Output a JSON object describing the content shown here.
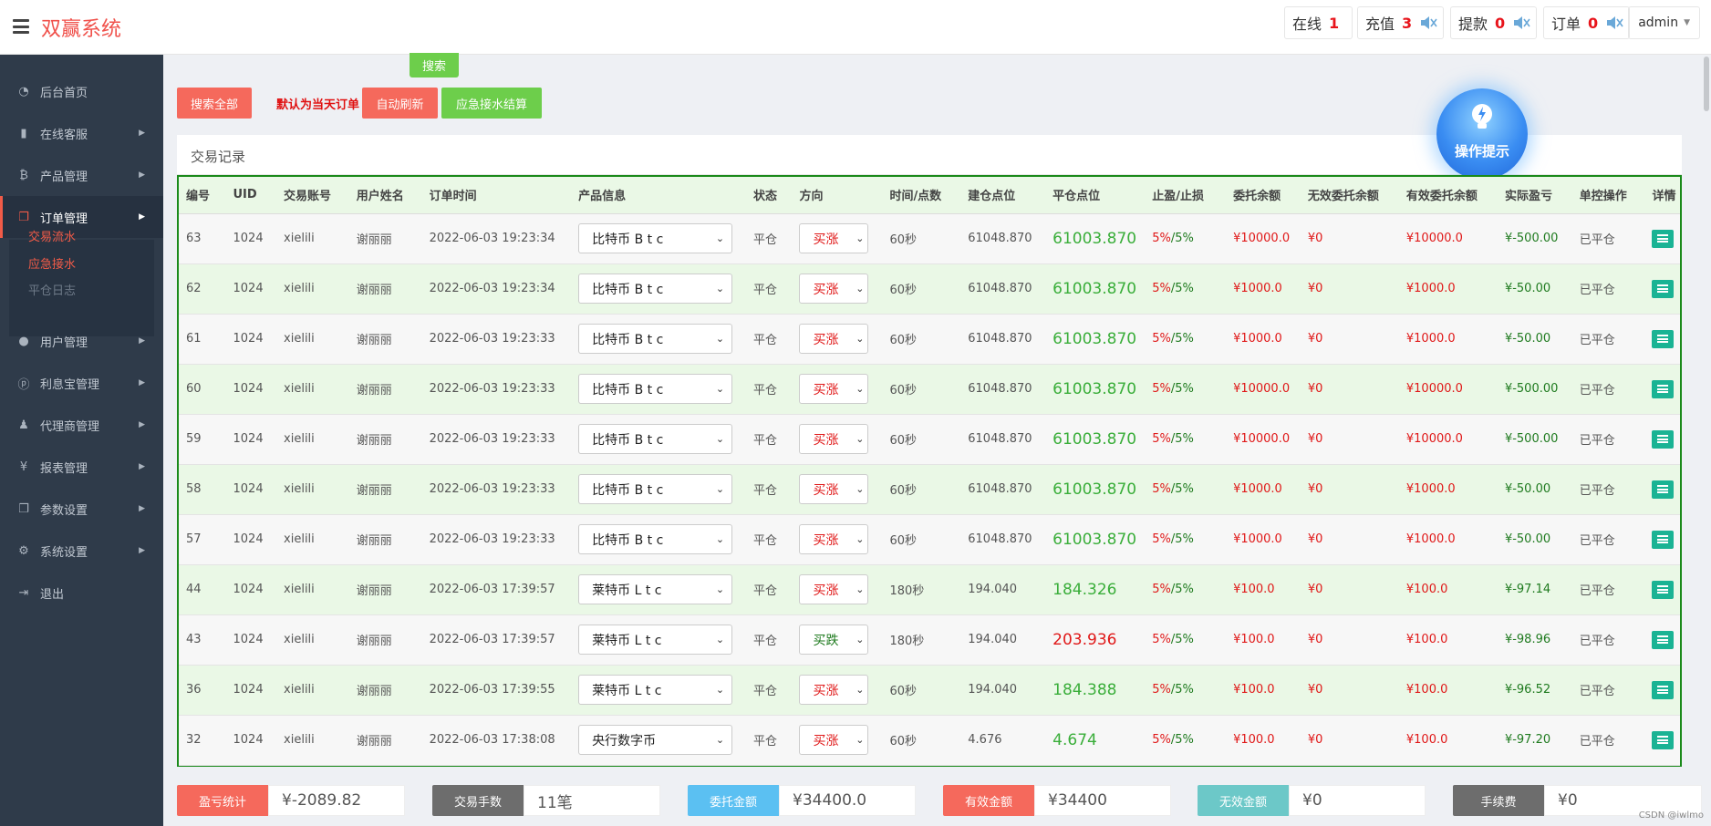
{
  "app": {
    "title": "双赢系统"
  },
  "header": {
    "online": {
      "label": "在线",
      "count": "1"
    },
    "recharge": {
      "label": "充值",
      "count": "3"
    },
    "withdraw": {
      "label": "提款",
      "count": "0"
    },
    "orders": {
      "label": "订单",
      "count": "0"
    },
    "user": "admin"
  },
  "sidebar": {
    "items": [
      {
        "label": "后台首页",
        "icon": "dashboard-icon"
      },
      {
        "label": "在线客服",
        "icon": "book-icon"
      },
      {
        "label": "产品管理",
        "icon": "bitcoin-icon"
      },
      {
        "label": "订单管理",
        "icon": "copy-icon"
      },
      {
        "label": "用户管理",
        "icon": "user-icon"
      },
      {
        "label": "利息宝管理",
        "icon": "pinterest-icon"
      },
      {
        "label": "代理商管理",
        "icon": "agent-icon"
      },
      {
        "label": "报表管理",
        "icon": "yen-icon"
      },
      {
        "label": "参数设置",
        "icon": "copy-icon"
      },
      {
        "label": "系统设置",
        "icon": "gears-icon"
      },
      {
        "label": "退出",
        "icon": "sign-out-icon"
      }
    ],
    "submenu": [
      "交易流水",
      "应急接水",
      "平仓日志"
    ]
  },
  "toolbar": {
    "search": "搜索",
    "search_all": "搜索全部",
    "default_note": "默认为当天订单",
    "auto_refresh": "自动刷新",
    "emergency_settle": "应急接水结算"
  },
  "panel": {
    "title": "交易记录"
  },
  "tip": {
    "label": "操作提示"
  },
  "table": {
    "headers": [
      "编号",
      "UID",
      "交易账号",
      "用户姓名",
      "订单时间",
      "产品信息",
      "状态",
      "方向",
      "时间/点数",
      "建仓点位",
      "平仓点位",
      "止盈/止损",
      "委托余额",
      "无效委托余额",
      "有效委托余额",
      "实际盈亏",
      "单控操作",
      "详情"
    ],
    "rows": [
      {
        "id": "63",
        "uid": "1024",
        "account": "xielili",
        "name": "谢丽丽",
        "time": "2022-06-03 19:23:34",
        "product": "比特币 B t c",
        "status": "平仓",
        "direction": "买涨",
        "duration": "60秒",
        "open": "61048.870",
        "close": "61003.870",
        "tp": "5%",
        "sl": "/5%",
        "amount": "¥10000.0",
        "invalid": "¥0",
        "valid": "¥10000.0",
        "pnl": "¥-500.00",
        "ctrl": "已平仓"
      },
      {
        "id": "62",
        "uid": "1024",
        "account": "xielili",
        "name": "谢丽丽",
        "time": "2022-06-03 19:23:34",
        "product": "比特币 B t c",
        "status": "平仓",
        "direction": "买涨",
        "duration": "60秒",
        "open": "61048.870",
        "close": "61003.870",
        "tp": "5%",
        "sl": "/5%",
        "amount": "¥1000.0",
        "invalid": "¥0",
        "valid": "¥1000.0",
        "pnl": "¥-50.00",
        "ctrl": "已平仓"
      },
      {
        "id": "61",
        "uid": "1024",
        "account": "xielili",
        "name": "谢丽丽",
        "time": "2022-06-03 19:23:33",
        "product": "比特币 B t c",
        "status": "平仓",
        "direction": "买涨",
        "duration": "60秒",
        "open": "61048.870",
        "close": "61003.870",
        "tp": "5%",
        "sl": "/5%",
        "amount": "¥1000.0",
        "invalid": "¥0",
        "valid": "¥1000.0",
        "pnl": "¥-50.00",
        "ctrl": "已平仓"
      },
      {
        "id": "60",
        "uid": "1024",
        "account": "xielili",
        "name": "谢丽丽",
        "time": "2022-06-03 19:23:33",
        "product": "比特币 B t c",
        "status": "平仓",
        "direction": "买涨",
        "duration": "60秒",
        "open": "61048.870",
        "close": "61003.870",
        "tp": "5%",
        "sl": "/5%",
        "amount": "¥10000.0",
        "invalid": "¥0",
        "valid": "¥10000.0",
        "pnl": "¥-500.00",
        "ctrl": "已平仓"
      },
      {
        "id": "59",
        "uid": "1024",
        "account": "xielili",
        "name": "谢丽丽",
        "time": "2022-06-03 19:23:33",
        "product": "比特币 B t c",
        "status": "平仓",
        "direction": "买涨",
        "duration": "60秒",
        "open": "61048.870",
        "close": "61003.870",
        "tp": "5%",
        "sl": "/5%",
        "amount": "¥10000.0",
        "invalid": "¥0",
        "valid": "¥10000.0",
        "pnl": "¥-500.00",
        "ctrl": "已平仓"
      },
      {
        "id": "58",
        "uid": "1024",
        "account": "xielili",
        "name": "谢丽丽",
        "time": "2022-06-03 19:23:33",
        "product": "比特币 B t c",
        "status": "平仓",
        "direction": "买涨",
        "duration": "60秒",
        "open": "61048.870",
        "close": "61003.870",
        "tp": "5%",
        "sl": "/5%",
        "amount": "¥1000.0",
        "invalid": "¥0",
        "valid": "¥1000.0",
        "pnl": "¥-50.00",
        "ctrl": "已平仓"
      },
      {
        "id": "57",
        "uid": "1024",
        "account": "xielili",
        "name": "谢丽丽",
        "time": "2022-06-03 19:23:33",
        "product": "比特币 B t c",
        "status": "平仓",
        "direction": "买涨",
        "duration": "60秒",
        "open": "61048.870",
        "close": "61003.870",
        "tp": "5%",
        "sl": "/5%",
        "amount": "¥1000.0",
        "invalid": "¥0",
        "valid": "¥1000.0",
        "pnl": "¥-50.00",
        "ctrl": "已平仓"
      },
      {
        "id": "44",
        "uid": "1024",
        "account": "xielili",
        "name": "谢丽丽",
        "time": "2022-06-03 17:39:57",
        "product": "莱特币 L t c",
        "status": "平仓",
        "direction": "买涨",
        "duration": "180秒",
        "open": "194.040",
        "close": "184.326",
        "tp": "5%",
        "sl": "/5%",
        "amount": "¥100.0",
        "invalid": "¥0",
        "valid": "¥100.0",
        "pnl": "¥-97.14",
        "ctrl": "已平仓"
      },
      {
        "id": "43",
        "uid": "1024",
        "account": "xielili",
        "name": "谢丽丽",
        "time": "2022-06-03 17:39:57",
        "product": "莱特币 L t c",
        "status": "平仓",
        "direction": "买跌",
        "duration": "180秒",
        "open": "194.040",
        "close": "203.936",
        "tp": "5%",
        "sl": "/5%",
        "amount": "¥100.0",
        "invalid": "¥0",
        "valid": "¥100.0",
        "pnl": "¥-98.96",
        "ctrl": "已平仓"
      },
      {
        "id": "36",
        "uid": "1024",
        "account": "xielili",
        "name": "谢丽丽",
        "time": "2022-06-03 17:39:55",
        "product": "莱特币 L t c",
        "status": "平仓",
        "direction": "买涨",
        "duration": "60秒",
        "open": "194.040",
        "close": "184.388",
        "tp": "5%",
        "sl": "/5%",
        "amount": "¥100.0",
        "invalid": "¥0",
        "valid": "¥100.0",
        "pnl": "¥-96.52",
        "ctrl": "已平仓"
      },
      {
        "id": "32",
        "uid": "1024",
        "account": "xielili",
        "name": "谢丽丽",
        "time": "2022-06-03 17:38:08",
        "product": "央行数字币",
        "status": "平仓",
        "direction": "买涨",
        "duration": "60秒",
        "open": "4.676",
        "close": "4.674",
        "tp": "5%",
        "sl": "/5%",
        "amount": "¥100.0",
        "invalid": "¥0",
        "valid": "¥100.0",
        "pnl": "¥-97.20",
        "ctrl": "已平仓"
      }
    ]
  },
  "stats": [
    {
      "label": "盈亏统计",
      "value": "¥-2089.82",
      "color": "#f5695c"
    },
    {
      "label": "交易手数",
      "value": "11笔",
      "color": "#6d6d6d"
    },
    {
      "label": "委托金额",
      "value": "¥34400.0",
      "color": "#5bc0f2"
    },
    {
      "label": "有效金额",
      "value": "¥34400",
      "color": "#f5695c"
    },
    {
      "label": "无效金额",
      "value": "¥0",
      "color": "#6cc8c8"
    },
    {
      "label": "手续费",
      "value": "¥0",
      "color": "#6d6d6d"
    }
  ],
  "watermark": "CSDN @iwlmo"
}
